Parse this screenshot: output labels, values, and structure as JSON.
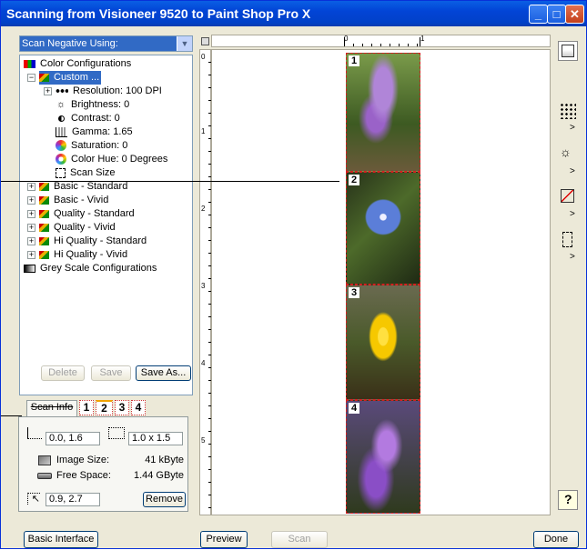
{
  "window": {
    "title": "Scanning from Visioneer 9520 to Paint Shop Pro X",
    "controls": {
      "minimize": "_",
      "maximize": "□",
      "close": "✕"
    }
  },
  "scan_using": {
    "selected": "Scan Negative Using:"
  },
  "tree": {
    "color_configurations": "Color Configurations",
    "custom": "Custom ...",
    "resolution": "Resolution: 100 DPI",
    "brightness": "Brightness: 0",
    "contrast": "Contrast: 0",
    "gamma": "Gamma: 1.65",
    "saturation": "Saturation: 0",
    "color_hue": "Color Hue: 0 Degrees",
    "scan_size": "Scan Size",
    "basic_standard": "Basic - Standard",
    "basic_vivid": "Basic - Vivid",
    "quality_standard": "Quality - Standard",
    "quality_vivid": "Quality - Vivid",
    "hi_quality_standard": "Hi Quality - Standard",
    "hi_quality_vivid": "Hi Quality - Vivid",
    "grey_scale": "Grey Scale Configurations"
  },
  "config_buttons": {
    "delete": "Delete",
    "save": "Save",
    "save_as": "Save As..."
  },
  "tabs": {
    "scan_info": "Scan Info",
    "t1": "1",
    "t2": "2",
    "t3": "3",
    "t4": "4"
  },
  "scan_info": {
    "origin": "0.0, 1.6",
    "size": "1.0 x 1.5",
    "image_size_label": "Image Size:",
    "image_size_value": "41 kByte",
    "free_space_label": "Free Space:",
    "free_space_value": "1.44 GByte",
    "cursor_pos": "0.9, 2.7",
    "remove": "Remove"
  },
  "rulers": {
    "h": [
      "0",
      "1"
    ],
    "v": [
      "0",
      "1",
      "2",
      "3",
      "4",
      "5"
    ]
  },
  "frames": [
    "1",
    "2",
    "3",
    "4"
  ],
  "bottom": {
    "basic_interface": "Basic Interface",
    "preview": "Preview",
    "scan": "Scan",
    "done": "Done"
  },
  "icons": [
    "document-properties-icon",
    "halftone-icon",
    "brightness-contrast-icon",
    "color-curve-icon",
    "scan-size-icon",
    "help-icon"
  ]
}
